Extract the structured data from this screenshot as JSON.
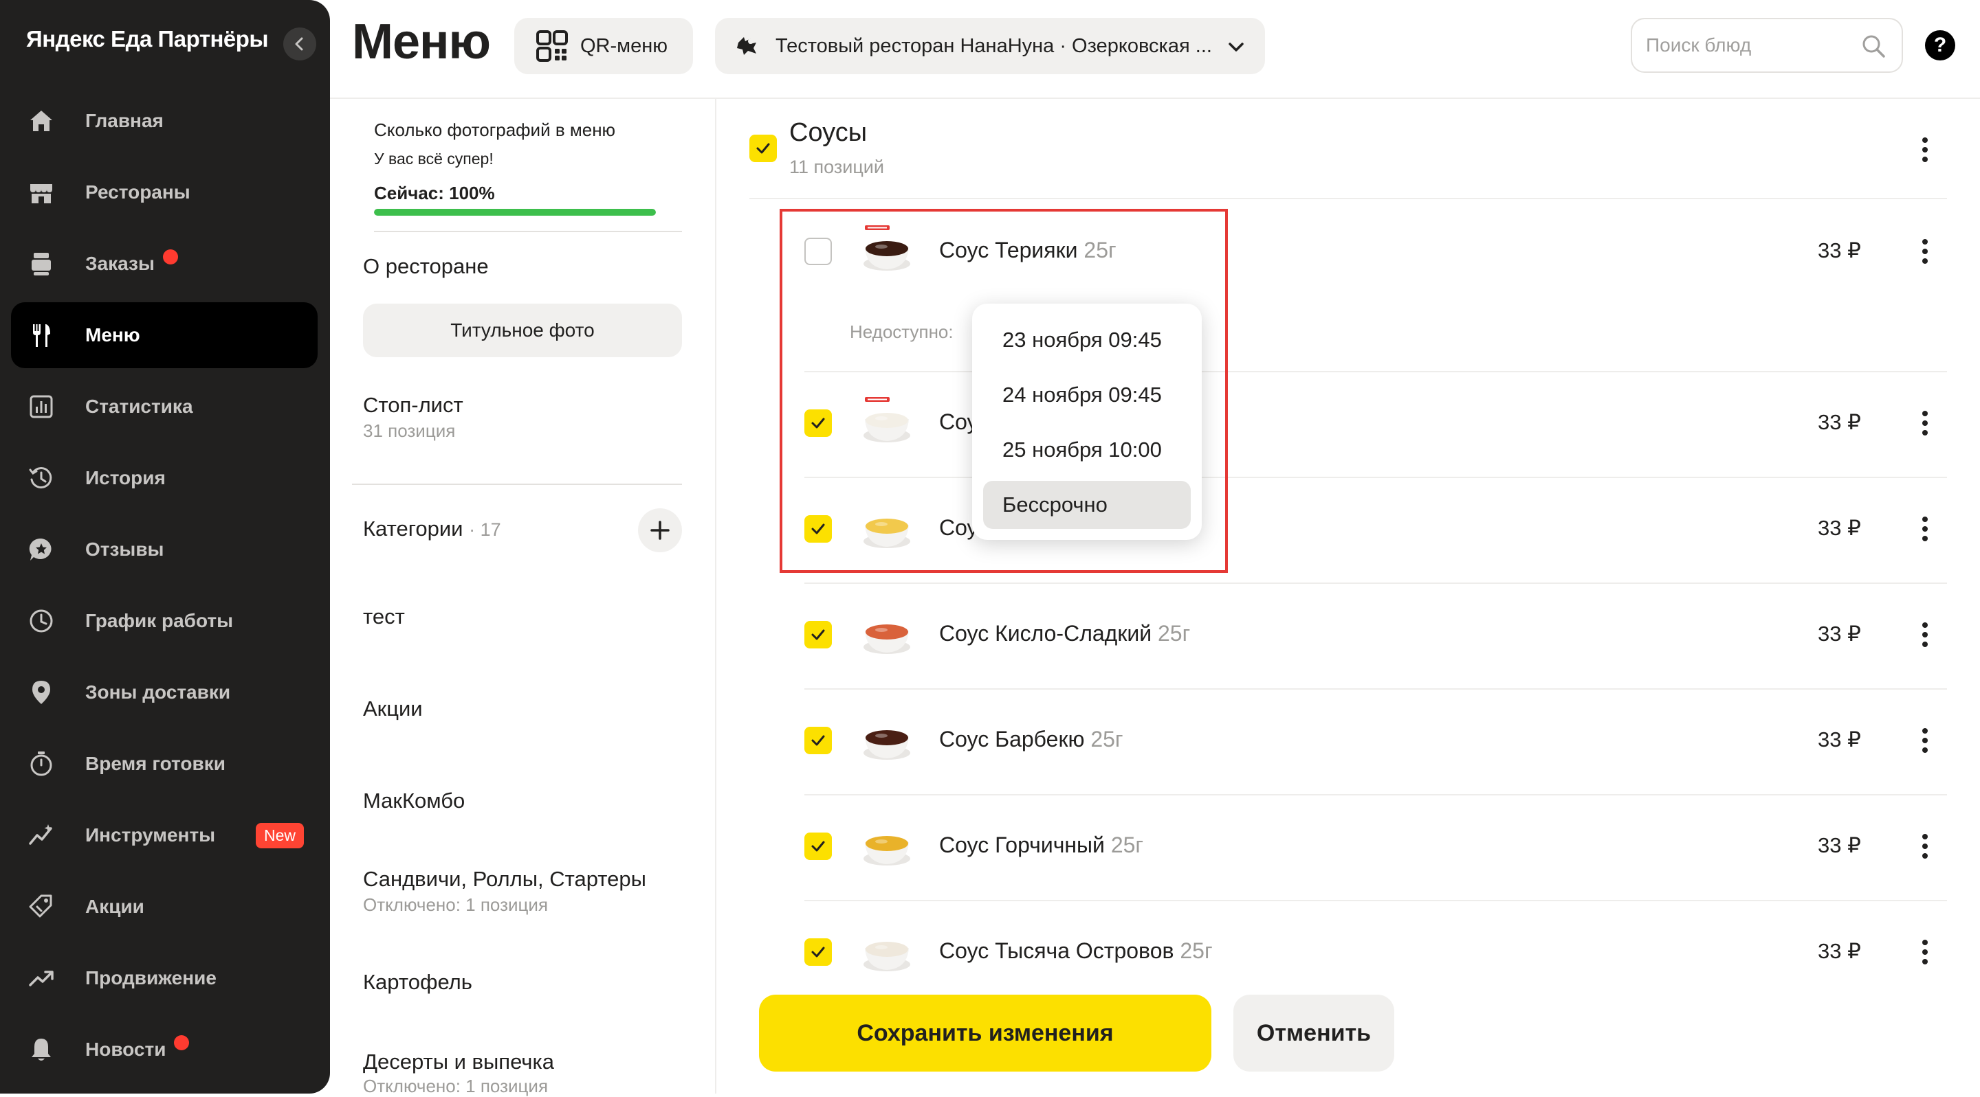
{
  "sidebar": {
    "brand": "Яндекс Еда Партнёры",
    "items": [
      {
        "label": "Главная",
        "icon": "home-icon"
      },
      {
        "label": "Рестораны",
        "icon": "store-icon"
      },
      {
        "label": "Заказы",
        "icon": "orders-icon",
        "dot": true
      },
      {
        "label": "Меню",
        "icon": "fork-knife-icon",
        "active": true
      },
      {
        "label": "Статистика",
        "icon": "chart-icon"
      },
      {
        "label": "История",
        "icon": "history-icon"
      },
      {
        "label": "Отзывы",
        "icon": "reviews-icon"
      },
      {
        "label": "График работы",
        "icon": "clock-icon"
      },
      {
        "label": "Зоны доставки",
        "icon": "location-pin-icon"
      },
      {
        "label": "Время готовки",
        "icon": "timer-icon"
      },
      {
        "label": "Инструменты",
        "icon": "tools-icon",
        "badge": "New"
      },
      {
        "label": "Акции",
        "icon": "tag-icon"
      },
      {
        "label": "Продвижение",
        "icon": "trend-icon"
      },
      {
        "label": "Новости",
        "icon": "bell-icon",
        "dot": true
      }
    ]
  },
  "header": {
    "title": "Меню",
    "qr_label": "QR-меню",
    "restaurant_label": "Тестовый ресторан НанаНуна · Озерковская ...",
    "search_placeholder": "Поиск блюд",
    "help_label": "?"
  },
  "left_panel": {
    "photos_title": "Сколько фотографий в меню",
    "photos_sub": "У вас всё супер!",
    "photos_now": "Сейчас: 100%",
    "photos_progress": 1.0,
    "about_title": "О ресторане",
    "photo_button": "Титульное фото",
    "stoplist_title": "Стоп-лист",
    "stoplist_sub": "31 позиция",
    "categories_title": "Категории",
    "categories_count": "· 17",
    "categories": [
      {
        "name": "тест",
        "sub": ""
      },
      {
        "name": "Акции",
        "sub": ""
      },
      {
        "name": "МакКомбо",
        "sub": ""
      },
      {
        "name": "Сандвичи, Роллы, Стартеры",
        "sub": "Отключено: 1 позиция"
      },
      {
        "name": "Картофель",
        "sub": ""
      },
      {
        "name": "Десерты и выпечка",
        "sub": "Отключено: 1 позиция"
      }
    ]
  },
  "group": {
    "title": "Соусы",
    "sub": "11 позиций",
    "checked": true
  },
  "items": [
    {
      "name": "Соус Терияки",
      "weight": "25г",
      "price": "33 ₽",
      "checked": false,
      "sauce_color": "#3a1c12"
    },
    {
      "name": "Соу",
      "weight": "",
      "price": "33 ₽",
      "checked": true,
      "sauce_color": "#f3efe6"
    },
    {
      "name": "Соу",
      "weight": "",
      "price": "33 ₽",
      "checked": true,
      "sauce_color": "#f2c94c"
    },
    {
      "name": "Соус Кисло-Сладкий",
      "weight": "25г",
      "price": "33 ₽",
      "checked": true,
      "sauce_color": "#d9623b"
    },
    {
      "name": "Соус Барбекю",
      "weight": "25г",
      "price": "33 ₽",
      "checked": true,
      "sauce_color": "#4a1f14"
    },
    {
      "name": "Соус Горчичный",
      "weight": "25г",
      "price": "33 ₽",
      "checked": true,
      "sauce_color": "#e9b22a"
    },
    {
      "name": "Соус Тысяча Островов",
      "weight": "25г",
      "price": "33 ₽",
      "checked": true,
      "sauce_color": "#efe8dc"
    }
  ],
  "unavailable_label": "Недоступно:",
  "dropdown": {
    "options": [
      {
        "label": "23 ноября 09:45",
        "selected": false
      },
      {
        "label": "24 ноября 09:45",
        "selected": false
      },
      {
        "label": "25 ноября 10:00",
        "selected": false
      },
      {
        "label": "Бессрочно",
        "selected": true
      }
    ]
  },
  "footer": {
    "save_label": "Сохранить изменения",
    "cancel_label": "Отменить"
  },
  "colors": {
    "accent_yellow": "#fce000",
    "sidebar_bg": "#21201f",
    "highlight_red": "#e53935",
    "progress_green": "#3dbf4c",
    "badge_red": "#ff4433"
  }
}
